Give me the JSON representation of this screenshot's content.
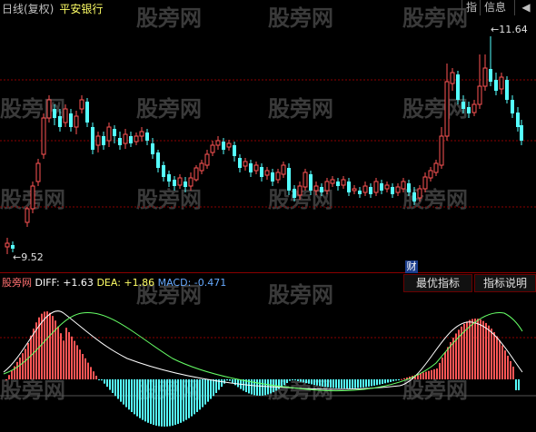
{
  "header": {
    "period_label": "日线(复权)",
    "stock_name": "平安银行",
    "buttons": [
      {
        "label": "指"
      },
      {
        "label": "信息"
      }
    ]
  },
  "watermark": "股旁网",
  "price_labels": {
    "high": "11.64",
    "low": "9.52"
  },
  "macd_legend": {
    "name": "股旁网",
    "diff": "DIFF: +1.63",
    "dea": "DEA: +1.86",
    "macd": "MACD: -0.471"
  },
  "finance_badge": "财",
  "panel_buttons": [
    {
      "label": "最优指标"
    },
    {
      "label": "指标说明"
    }
  ],
  "colors": {
    "up": "#ff5555",
    "down": "#55ffff",
    "diff": "#ffffff",
    "dea": "#ffff66",
    "ma": "#66ff66"
  }
}
